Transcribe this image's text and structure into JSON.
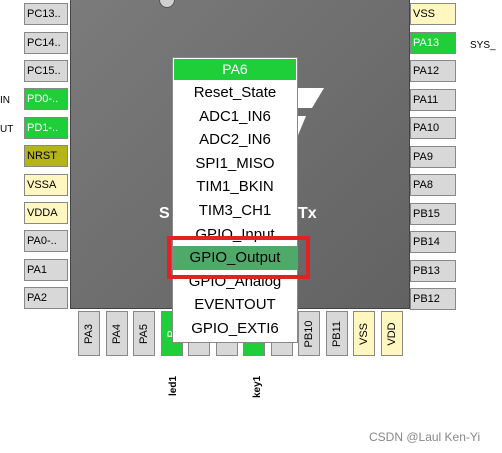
{
  "chip": {
    "name_left": "S",
    "name_right": "Tx"
  },
  "left_pins": [
    {
      "label": "PC13..",
      "color": "gray"
    },
    {
      "label": "PC14..",
      "color": "gray"
    },
    {
      "label": "PC15..",
      "color": "gray"
    },
    {
      "label": "PD0-..",
      "color": "green"
    },
    {
      "label": "PD1-..",
      "color": "green"
    },
    {
      "label": "NRST",
      "color": "olive"
    },
    {
      "label": "VSSA",
      "color": "cream"
    },
    {
      "label": "VDDA",
      "color": "cream"
    },
    {
      "label": "PA0-..",
      "color": "gray"
    },
    {
      "label": "PA1",
      "color": "gray"
    },
    {
      "label": "PA2",
      "color": "gray"
    }
  ],
  "left_ext_labels": [
    "IN",
    "UT"
  ],
  "right_pins": [
    {
      "label": "VSS",
      "color": "cream"
    },
    {
      "label": "PA13",
      "color": "green"
    },
    {
      "label": "PA12",
      "color": "gray"
    },
    {
      "label": "PA11",
      "color": "gray"
    },
    {
      "label": "PA10",
      "color": "gray"
    },
    {
      "label": "PA9",
      "color": "gray"
    },
    {
      "label": "PA8",
      "color": "gray"
    },
    {
      "label": "PB15",
      "color": "gray"
    },
    {
      "label": "PB14",
      "color": "gray"
    },
    {
      "label": "PB13",
      "color": "gray"
    },
    {
      "label": "PB12",
      "color": "gray"
    }
  ],
  "right_ext_label": "SYS_",
  "bottom_pins": [
    {
      "label": "PA3",
      "color": "gray"
    },
    {
      "label": "PA4",
      "color": "gray"
    },
    {
      "label": "PA5",
      "color": "gray"
    },
    {
      "label": "P",
      "color": "green"
    },
    {
      "label": "P",
      "color": "gray"
    },
    {
      "label": "P",
      "color": "gray"
    },
    {
      "label": "P",
      "color": "green"
    },
    {
      "label": "P",
      "color": "gray"
    },
    {
      "label": "PB10",
      "color": "gray"
    },
    {
      "label": "PB11",
      "color": "gray"
    },
    {
      "label": "VSS",
      "color": "cream"
    },
    {
      "label": "VDD",
      "color": "cream"
    }
  ],
  "bottom_ext_labels": [
    "led1",
    "key1"
  ],
  "menu": {
    "title": "PA6",
    "items": [
      "Reset_State",
      "ADC1_IN6",
      "ADC2_IN6",
      "SPI1_MISO",
      "TIM1_BKIN",
      "TIM3_CH1",
      "GPIO_Input",
      "GPIO_Output",
      "GPIO_Analog",
      "EVENTOUT",
      "GPIO_EXTI6"
    ],
    "selected": "GPIO_Output"
  },
  "watermark": "CSDN @Laul Ken-Yi",
  "colors": {
    "green": "#1ecf3a",
    "highlight": "#e02222",
    "selected": "#4faa6a"
  }
}
